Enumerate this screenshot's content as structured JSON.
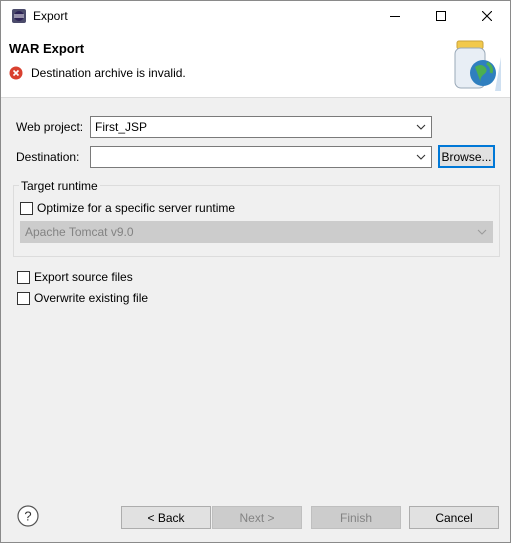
{
  "window": {
    "title": "Export",
    "icon": "eclipse-app-icon",
    "controls": [
      "minimize-icon",
      "maximize-icon",
      "close-icon"
    ]
  },
  "banner": {
    "title": "WAR Export",
    "message": "Destination archive is invalid.",
    "message_icon": "error-icon",
    "graphic": "export-jar-globe-icon"
  },
  "form": {
    "web_project_label": "Web project:",
    "web_project_value": "First_JSP",
    "destination_label": "Destination:",
    "destination_value": "",
    "browse_label": "Browse..."
  },
  "target_runtime": {
    "group_label": "Target runtime",
    "optimize_label": "Optimize for a specific server runtime",
    "optimize_checked": false,
    "runtime_value": "Apache Tomcat v9.0"
  },
  "options": {
    "export_source_label": "Export source files",
    "export_source_checked": false,
    "overwrite_label": "Overwrite existing file",
    "overwrite_checked": false
  },
  "footer": {
    "help_icon": "help-icon",
    "back_label": "< Back",
    "next_label": "Next >",
    "finish_label": "Finish",
    "cancel_label": "Cancel"
  },
  "colors": {
    "accent": "#0078d7",
    "error": "#d9402f",
    "dialog_bg": "#f0f0f0"
  }
}
